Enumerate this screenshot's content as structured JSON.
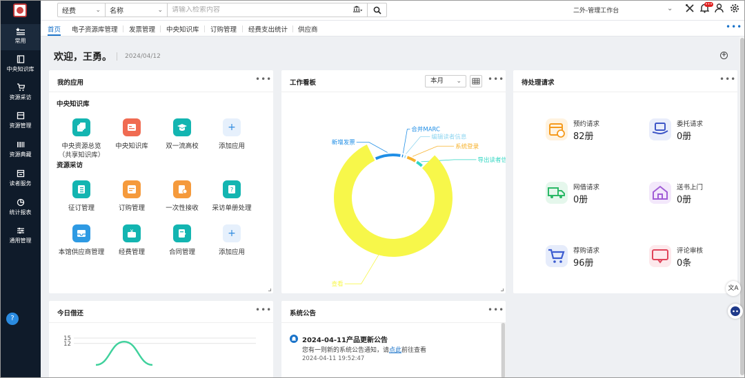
{
  "sidebar": {
    "items": [
      {
        "label": "常用",
        "icon": "star-list-icon"
      },
      {
        "label": "中央知识库",
        "icon": "book-icon"
      },
      {
        "label": "资源采访",
        "icon": "cart-icon"
      },
      {
        "label": "资源管理",
        "icon": "box-icon"
      },
      {
        "label": "资源典藏",
        "icon": "barcode-icon"
      },
      {
        "label": "读者服务",
        "icon": "reader-icon"
      },
      {
        "label": "统计报表",
        "icon": "pie-chart-icon"
      },
      {
        "label": "通用管理",
        "icon": "sliders-icon"
      }
    ]
  },
  "search": {
    "category": "经费",
    "field": "名称",
    "placeholder": "请输入检索内容"
  },
  "header": {
    "workbench": "二外-管理工作台"
  },
  "tabs": [
    "首页",
    "电子资源库管理",
    "发票管理",
    "中央知识库",
    "订购管理",
    "经费支出统计",
    "供应商"
  ],
  "welcome": {
    "greeting": "欢迎，王勇。",
    "date": "2024/04/12"
  },
  "my_apps": {
    "title": "我的应用",
    "sections": [
      {
        "title": "中央知识库",
        "apps": [
          {
            "label": "中央资源总览",
            "sub": "（共享知识库）"
          },
          {
            "label": "中央知识库",
            "sub": ""
          },
          {
            "label": "双一流高校",
            "sub": ""
          },
          {
            "label": "添加应用",
            "sub": ""
          }
        ]
      },
      {
        "title": "资源采访",
        "apps": [
          {
            "label": "征订管理"
          },
          {
            "label": "订购管理"
          },
          {
            "label": "一次性接收"
          },
          {
            "label": "采访单册处理"
          },
          {
            "label": "本馆供应商管理"
          },
          {
            "label": "经费管理"
          },
          {
            "label": "合同管理"
          },
          {
            "label": "添加应用"
          }
        ]
      }
    ]
  },
  "board": {
    "title": "工作看板",
    "period": "本月",
    "chart_data": {
      "type": "pie",
      "labels": [
        "新增发票",
        "合并MARC",
        "编辑读者信息",
        "系统登录",
        "导出读者信息",
        "查看"
      ],
      "values": [
        10,
        1,
        1,
        4,
        3,
        81
      ],
      "colors": [
        "#1f8ee6",
        "#1f8ee6",
        "#8fd6f0",
        "#f7b22c",
        "#2fd6c2",
        "#f7f74a"
      ]
    }
  },
  "pending": {
    "title": "待处理请求",
    "items": [
      {
        "label": "预约请求",
        "value": "82册",
        "icon": "calendar-clock-icon",
        "bg": "#fff3e0",
        "fg": "#f59a1c"
      },
      {
        "label": "委托请求",
        "value": "0册",
        "icon": "hand-book-icon",
        "bg": "#e9edfb",
        "fg": "#3d55c7"
      },
      {
        "label": "网借请求",
        "value": "0册",
        "icon": "truck-icon",
        "bg": "#e5f7ec",
        "fg": "#2bb866"
      },
      {
        "label": "送书上门",
        "value": "0册",
        "icon": "home-icon",
        "bg": "#f3e8fb",
        "fg": "#a05cd6"
      },
      {
        "label": "荐购请求",
        "value": "96册",
        "icon": "cart-icon",
        "bg": "#e6ecfb",
        "fg": "#3b5bd0"
      },
      {
        "label": "评论审核",
        "value": "0条",
        "icon": "comment-icon",
        "bg": "#fde9ec",
        "fg": "#e0445a"
      }
    ]
  },
  "loans": {
    "title": "今日借还",
    "chart_data": {
      "type": "line",
      "y_ticks": [
        "15",
        "12"
      ],
      "ylim": [
        0,
        15
      ],
      "series": [
        {
          "values": [
            0,
            13,
            0
          ],
          "color": "#3fd19c"
        }
      ]
    }
  },
  "notices": {
    "title": "系统公告",
    "items": [
      {
        "title": "2024-04-11产品更新公告",
        "body_pre": "您有一则新的系统公告通知，请",
        "link": "点此",
        "body_post": "前往查看",
        "time": "2024-04-11 19:52:47"
      }
    ]
  },
  "floating": {
    "translate": "文A"
  }
}
